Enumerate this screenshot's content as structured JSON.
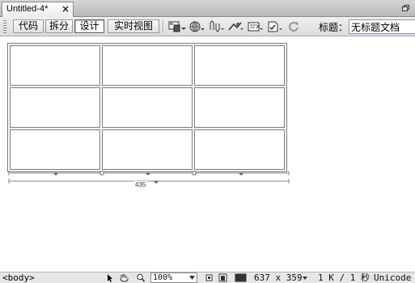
{
  "tab": {
    "title": "Untitled-4*",
    "close_glyph": "×",
    "restore_icon": "restore-window-icon"
  },
  "toolbar": {
    "views": [
      {
        "label": "代码",
        "active": false
      },
      {
        "label": "拆分",
        "active": false
      },
      {
        "label": "设计",
        "active": true
      },
      {
        "label": "实时视图",
        "active": false
      }
    ],
    "tools": [
      "multiscreen-icon",
      "live-view-icon",
      "file-management-icon",
      "browser-preview-icon",
      "visual-aids-icon",
      "validate-markup-icon",
      "refresh-icon"
    ],
    "title_label": "标题：",
    "title_value": "无标题文档"
  },
  "design": {
    "table": {
      "rows": 3,
      "columns": 3,
      "width_label": "435"
    }
  },
  "statusbar": {
    "tag_selector": "<body>",
    "tools": [
      "pointer-icon",
      "hand-icon",
      "zoom-icon"
    ],
    "zoom_value": "100%",
    "view_sizes": [
      "small-window-icon",
      "medium-window-icon",
      "large-window-icon"
    ],
    "window_size": "637 x 359",
    "download_stats": "1 K / 1 秒",
    "encoding": "Unicode"
  }
}
